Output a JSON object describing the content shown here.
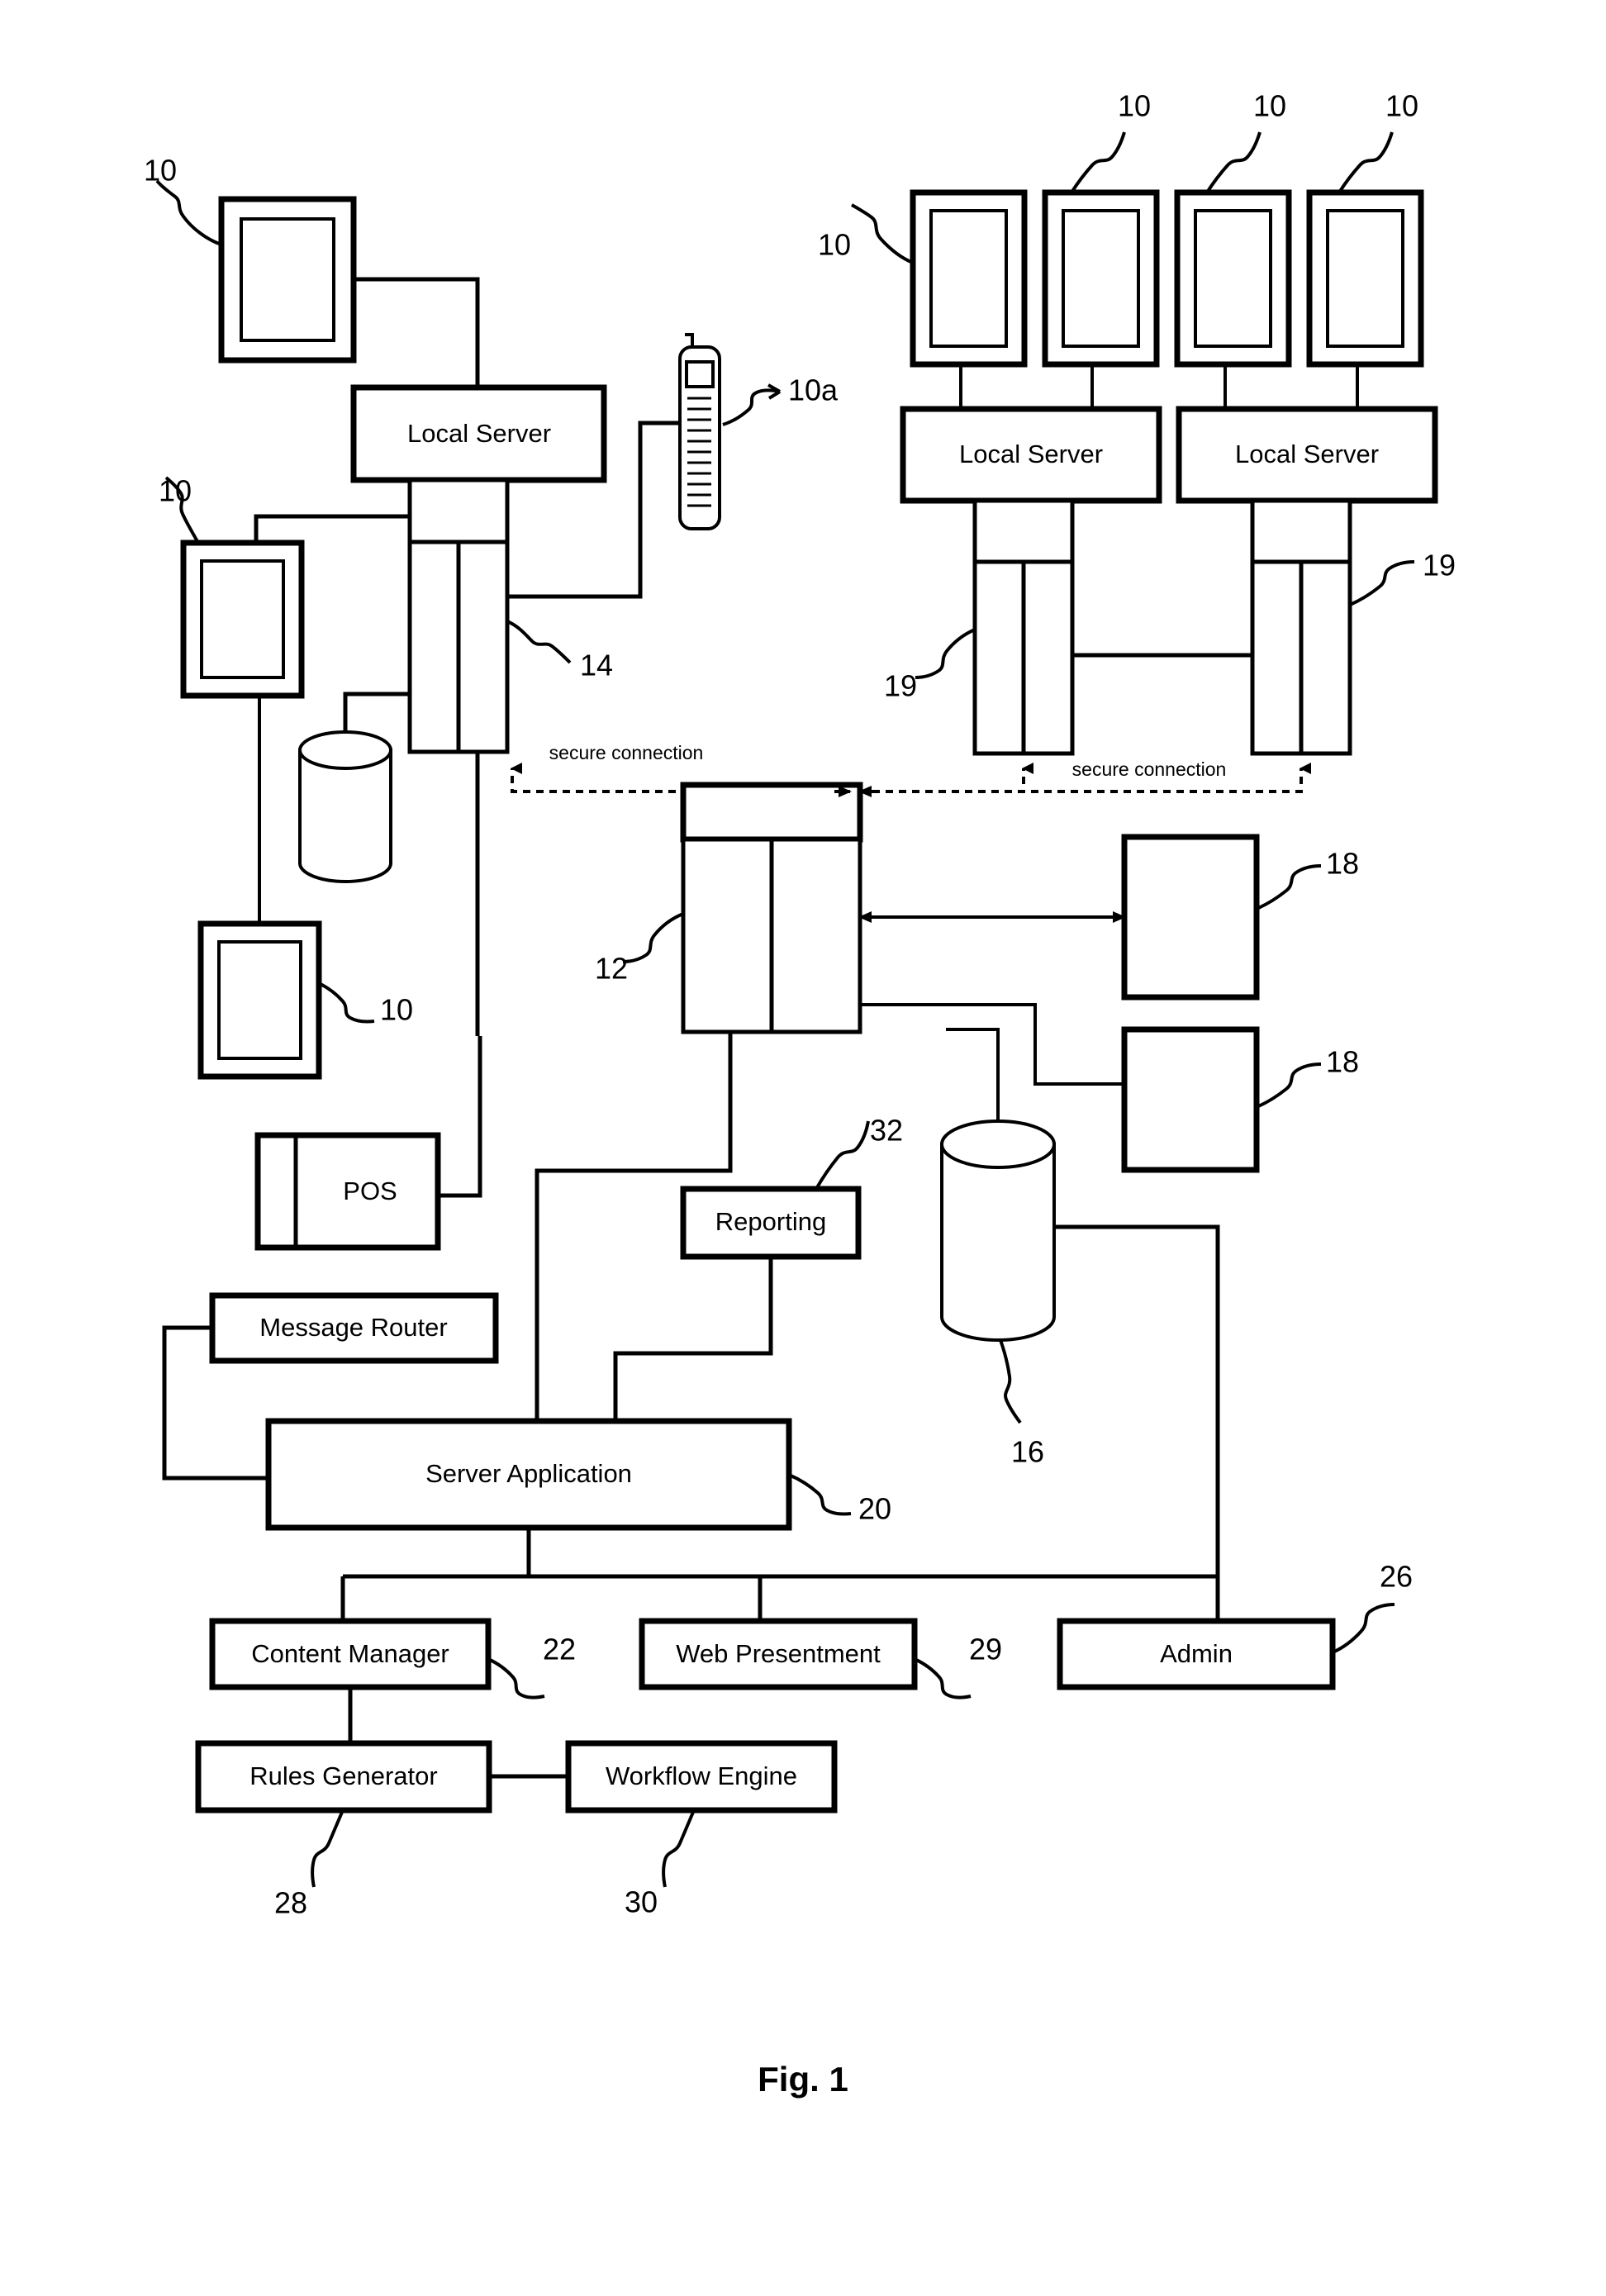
{
  "figure": {
    "caption": "Fig. 1",
    "title": "System architecture block diagram"
  },
  "nodes": {
    "local_server_left": "Local Server",
    "local_server_mid": "Local Server",
    "local_server_right": "Local Server",
    "pos": "POS",
    "message_router": "Message Router",
    "reporting": "Reporting",
    "server_application": "Server Application",
    "content_manager": "Content Manager",
    "web_presentment": "Web Presentment",
    "admin": "Admin",
    "rules_generator": "Rules Generator",
    "workflow_engine": "Workflow Engine"
  },
  "connection_labels": {
    "secure_left": "secure connection",
    "secure_right": "secure connection"
  },
  "reference_numerals": {
    "terminal_top_left": "10",
    "terminal_mid_left": "10",
    "terminal_bottom_left": "10",
    "terminal_group_first": "10",
    "terminal_group_second": "10",
    "terminal_group_third": "10",
    "terminal_group_fourth": "10",
    "mobile_device": "10a",
    "central_server": "12",
    "left_rack": "14",
    "database_main": "16",
    "external_box_upper": "18",
    "external_box_lower": "18",
    "rack_right_first": "19",
    "rack_right_second": "19",
    "server_application": "20",
    "content_manager": "22",
    "admin": "26",
    "rules_generator": "28",
    "web_presentment": "29",
    "workflow_engine": "30",
    "reporting": "32"
  }
}
